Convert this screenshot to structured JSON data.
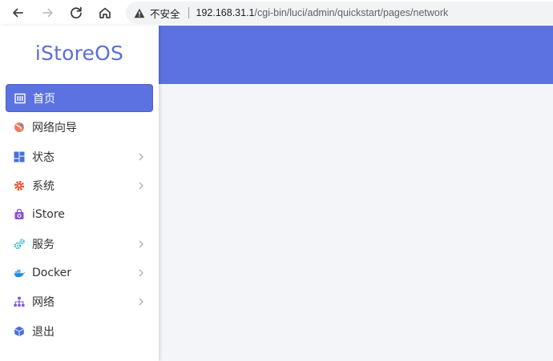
{
  "browser": {
    "security_label": "不安全",
    "url_host": "192.168.31.1",
    "url_path": "/cgi-bin/luci/admin/quickstart/pages/network"
  },
  "app": {
    "logo": "iStoreOS",
    "accent": "#5b72e0"
  },
  "sidebar": {
    "items": [
      {
        "label": "首页",
        "icon": "home-icon",
        "active": true,
        "has_submenu": false
      },
      {
        "label": "网络向导",
        "icon": "globe-icon",
        "active": false,
        "has_submenu": false
      },
      {
        "label": "状态",
        "icon": "dashboard-icon",
        "active": false,
        "has_submenu": true
      },
      {
        "label": "系统",
        "icon": "gear-icon",
        "active": false,
        "has_submenu": true
      },
      {
        "label": "iStore",
        "icon": "bag-icon",
        "active": false,
        "has_submenu": false
      },
      {
        "label": "服务",
        "icon": "cogs-icon",
        "active": false,
        "has_submenu": true
      },
      {
        "label": "Docker",
        "icon": "docker-icon",
        "active": false,
        "has_submenu": true
      },
      {
        "label": "网络",
        "icon": "network-icon",
        "active": false,
        "has_submenu": true
      },
      {
        "label": "退出",
        "icon": "cube-icon",
        "active": false,
        "has_submenu": false
      }
    ]
  }
}
